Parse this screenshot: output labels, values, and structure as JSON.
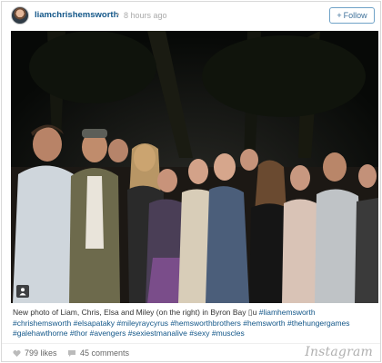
{
  "post": {
    "username": "liamchrishemsworth",
    "separator": "•",
    "time_ago": "8 hours ago",
    "follow_label": "Follow"
  },
  "caption": {
    "line1_text": "New photo of Liam, Chris, Elsa and Miley (on the right) in Byron Bay",
    "glyph": "▯",
    "line1_u": "u",
    "hashtags": [
      "#liamhemsworth",
      "#chrishemsworth",
      "#elsapataky",
      "#mileyraycyrus",
      "#hemsworthbrothers",
      "#hemsworth",
      "#thehungergames",
      "#galehawthorne",
      "#thor",
      "#avengers",
      "#sexiestmanalive",
      "#sexy",
      "#muscles"
    ]
  },
  "stats": {
    "likes": "799 likes",
    "comments": "45 comments"
  },
  "brand": "Instagram",
  "icons": {
    "avatar": "profile-avatar",
    "follow": "plus-icon",
    "photo_badge": "person-tag-icon",
    "likes": "heart-icon",
    "comments": "speech-bubble-icon"
  },
  "colors": {
    "link": "#125688",
    "follow_border": "#6fa2c7",
    "follow_text": "#3f729b",
    "muted": "#aaaaaa"
  }
}
